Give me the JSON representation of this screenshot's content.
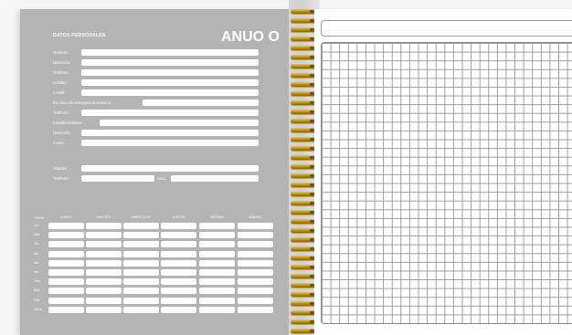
{
  "left_page": {
    "title": "DATOS PERSONALES",
    "logo": "ANUO O",
    "fields": [
      {
        "label": "Nombre:"
      },
      {
        "label": "Dirección:"
      },
      {
        "label": "Teléfono:"
      },
      {
        "label": "Celular:"
      },
      {
        "label": "e-mail:"
      },
      {
        "label": "En caso de emergencia avisar a:"
      },
      {
        "label": "Teléfono:"
      },
      {
        "label": "Establecimiento:"
      },
      {
        "label": "Dirección:"
      },
      {
        "label": "Curso:"
      }
    ],
    "extra_fields": [
      {
        "label": "Materia:"
      },
      {
        "label": "Teléfono:"
      },
      {
        "label": "Aula:"
      }
    ],
    "schedule": {
      "hora_label": "HORA",
      "days": [
        "LUNES",
        "MARTES",
        "MIÉRCOLES",
        "JUEVES",
        "VIERNES",
        "SÁBADO"
      ],
      "rows": [
        "1ra",
        "2da",
        "3ra",
        "4ta",
        "5ta",
        "6ta",
        "7ma",
        "8va",
        "9na",
        "10ma"
      ]
    }
  },
  "colors": {
    "left_page_bg": "#b4b4b4",
    "ring_gold": "#c79a2a",
    "grid_line": "#9c9c9c"
  }
}
